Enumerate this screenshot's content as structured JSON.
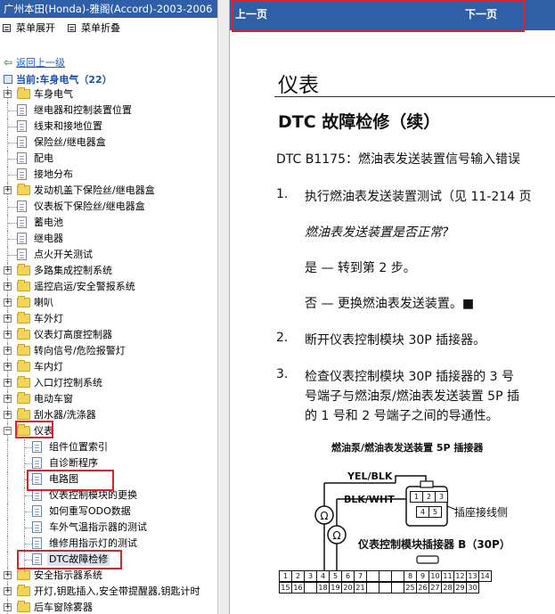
{
  "left_panel": {
    "title": "广州本田(Honda)-雅阁(Accord)-2003-2006",
    "toolbar": {
      "expand_all": "菜单展开",
      "collapse_all": "菜单折叠"
    },
    "back_link": "返回上一级",
    "current": "当前:车身电气（22）",
    "tree": [
      {
        "type": "folder",
        "label": "车身电气"
      },
      {
        "type": "doc",
        "label": "继电器和控制装置位置"
      },
      {
        "type": "doc",
        "label": "线束和接地位置"
      },
      {
        "type": "doc",
        "label": "保险丝/继电器盒"
      },
      {
        "type": "doc",
        "label": "配电"
      },
      {
        "type": "doc",
        "label": "接地分布"
      },
      {
        "type": "folder",
        "label": "发动机盖下保险丝/继电器盒"
      },
      {
        "type": "doc",
        "label": "仪表板下保险丝/继电器盒"
      },
      {
        "type": "doc",
        "label": "蓄电池"
      },
      {
        "type": "doc",
        "label": "继电器"
      },
      {
        "type": "doc",
        "label": "点火开关测试"
      },
      {
        "type": "folder",
        "label": "多路集成控制系统"
      },
      {
        "type": "folder",
        "label": "遥控启运/安全警报系统"
      },
      {
        "type": "folder",
        "label": "喇叭"
      },
      {
        "type": "folder",
        "label": "车外灯"
      },
      {
        "type": "folder",
        "label": "仪表灯高度控制器"
      },
      {
        "type": "folder",
        "label": "转向信号/危险报警灯"
      },
      {
        "type": "folder",
        "label": "车内灯"
      },
      {
        "type": "folder",
        "label": "入口灯控制系统"
      },
      {
        "type": "folder",
        "label": "电动车窗"
      },
      {
        "type": "folder",
        "label": "刮水器/洗涤器"
      },
      {
        "type": "folder-open",
        "label": "仪表"
      },
      {
        "type": "subdoc",
        "label": "组件位置索引"
      },
      {
        "type": "subdoc",
        "label": "自诊断程序"
      },
      {
        "type": "subdoc",
        "label": "电路图"
      },
      {
        "type": "subdoc",
        "label": "仪表控制模块的更换"
      },
      {
        "type": "subdoc",
        "label": "如何重写ODO数据"
      },
      {
        "type": "subdoc",
        "label": "车外气温指示器的测试"
      },
      {
        "type": "subdoc",
        "label": "维修用指示灯的测试"
      },
      {
        "type": "subdoc",
        "label": "DTC故障检修",
        "selected": true
      },
      {
        "type": "folder",
        "label": "安全指示器系统"
      },
      {
        "type": "folder",
        "label": "开灯,钥匙插入,安全带提醒器,钥匙计时"
      },
      {
        "type": "folder",
        "label": "后车窗除雾器"
      }
    ]
  },
  "right_panel": {
    "nav": {
      "prev": "上一页",
      "next": "下一页"
    },
    "doc": {
      "title": "仪表",
      "subtitle": "DTC 故障检修（续）",
      "dtc_line": "DTC B1175：燃油表发送装置信号输入错误",
      "step1_num": "1.",
      "step1_text": "执行燃油表发送装置测试（见 11-214 页",
      "step1_question": "燃油表发送装置是否正常?",
      "step1_yes": "是 — 转到第 2 步。",
      "step1_no": "否 — 更换燃油表发送装置。■",
      "step2_num": "2.",
      "step2_text": "断开仪表控制模块 30P 插接器。",
      "step3_num": "3.",
      "step3_line1": "检查仪表控制模块 30P 插接器的 3 号",
      "step3_line2": "号端子与燃油泵/燃油表发送装置 5P 插",
      "step3_line3": "的 1 号和 2 号端子之间的导通性。",
      "diagram": {
        "title": "燃油泵/燃油表发送装置 5P 插接器",
        "wire1": "YEL/BLK",
        "wire2": "BLK/WHT",
        "connector_side": "插座接线侧",
        "module_label": "仪表控制模块插接器 B（30P）",
        "pin_top": [
          "1",
          "2",
          "3",
          "4",
          "5",
          "6",
          "7",
          "",
          "",
          "",
          "8",
          "9",
          "10",
          "11",
          "12",
          "13",
          "14"
        ],
        "pin_bottom": [
          "15",
          "16",
          "",
          "18",
          "19",
          "20",
          "21",
          "",
          "",
          "",
          "25",
          "26",
          "27",
          "28",
          "29",
          "30"
        ],
        "conn5p_top": [
          "1",
          "2",
          "3"
        ],
        "conn5p_bottom": [
          "4",
          "5"
        ]
      }
    }
  }
}
